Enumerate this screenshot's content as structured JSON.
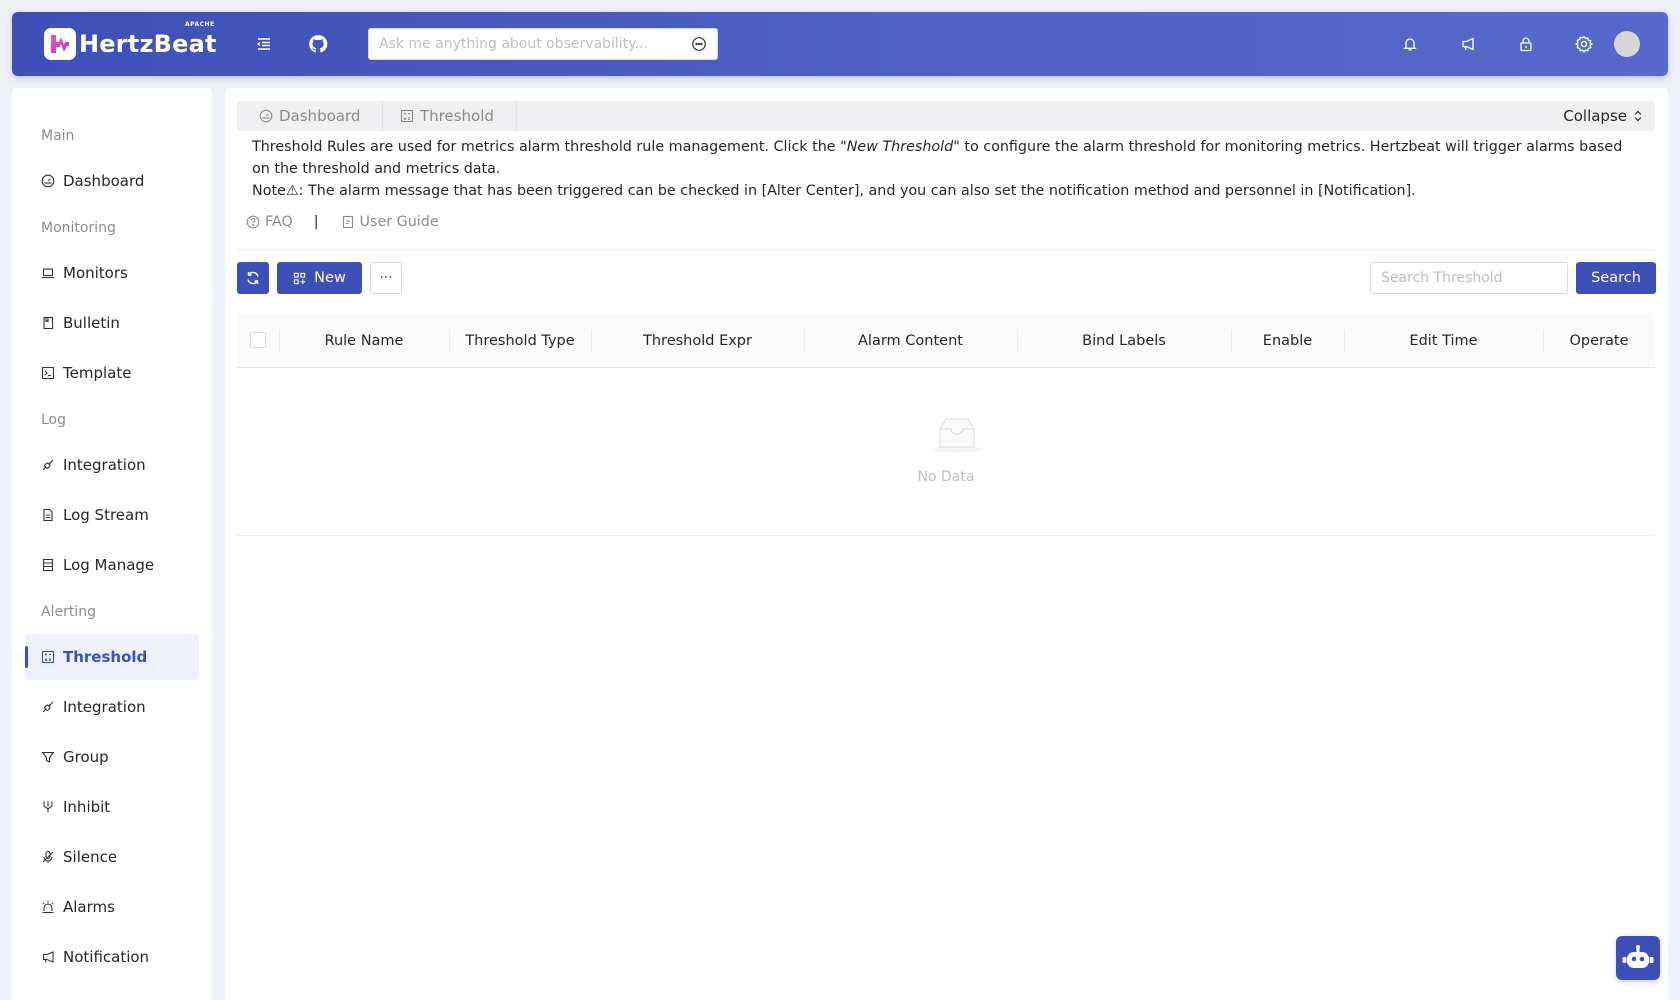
{
  "header": {
    "logo_text": "HertzBeat",
    "logo_badge": "APACHE",
    "search_placeholder": "Ask me anything about observability..."
  },
  "sidebar": {
    "groups": [
      "Main",
      "Monitoring",
      "Log",
      "Alerting"
    ],
    "items": [
      {
        "label": "Dashboard",
        "icon": "dashboard-icon"
      },
      {
        "label": "Monitors",
        "icon": "laptop-icon"
      },
      {
        "label": "Bulletin",
        "icon": "book-icon"
      },
      {
        "label": "Template",
        "icon": "code-icon"
      },
      {
        "label": "Integration",
        "icon": "api-icon"
      },
      {
        "label": "Log Stream",
        "icon": "file-icon"
      },
      {
        "label": "Log Manage",
        "icon": "database-icon"
      },
      {
        "label": "Threshold",
        "icon": "calculator-icon",
        "active": true
      },
      {
        "label": "Integration",
        "icon": "api-icon"
      },
      {
        "label": "Group",
        "icon": "filter-icon"
      },
      {
        "label": "Inhibit",
        "icon": "fork-icon"
      },
      {
        "label": "Silence",
        "icon": "mute-icon"
      },
      {
        "label": "Alarms",
        "icon": "alert-icon"
      },
      {
        "label": "Notification",
        "icon": "sound-icon"
      }
    ]
  },
  "tabs": {
    "items": [
      "Dashboard",
      "Threshold"
    ],
    "collapse_label": "Collapse"
  },
  "description": {
    "line1_pre": "Threshold Rules are used for metrics alarm threshold rule management. Click the \"",
    "line1_em": "New Threshold",
    "line1_post": "\" to configure the alarm threshold for monitoring metrics. Hertzbeat will trigger alarms based on the threshold and metrics data.",
    "line2": "Note⚠: The alarm message that has been triggered can be checked in [Alter Center], and you can also set the notification method and personnel in [Notification].",
    "faq": "FAQ",
    "separator": "|",
    "guide": "User Guide"
  },
  "toolbar": {
    "new_label": "New",
    "more_label": "···",
    "search_placeholder": "Search Threshold",
    "search_button": "Search"
  },
  "table": {
    "columns": [
      "Rule Name",
      "Threshold Type",
      "Threshold Expr",
      "Alarm Content",
      "Bind Labels",
      "Enable",
      "Edit Time",
      "Operate"
    ],
    "empty_text": "No Data"
  },
  "colors": {
    "primary": "#3e4fb8",
    "header_gradient_end": "#5769cb"
  }
}
